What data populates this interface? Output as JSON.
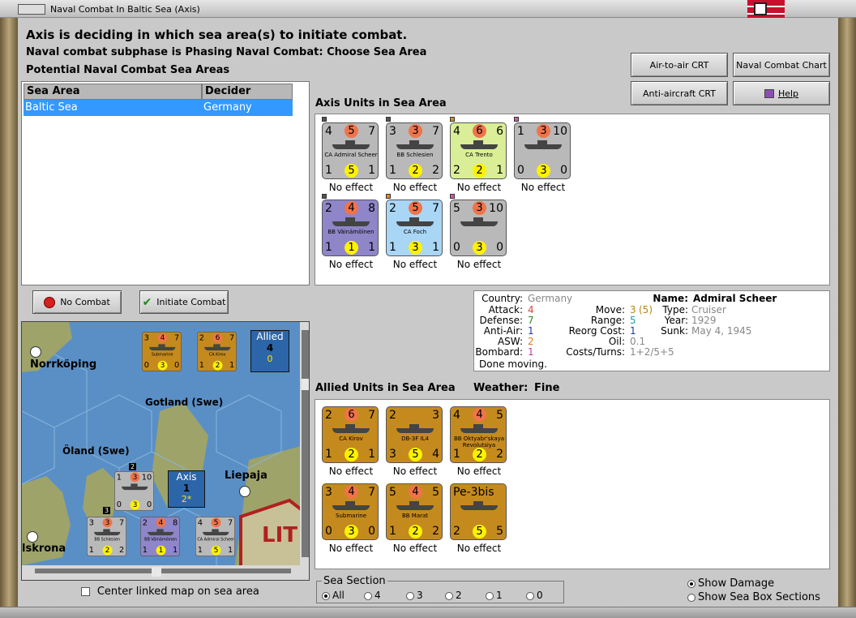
{
  "window": {
    "title": "Naval Combat In Baltic Sea (Axis)"
  },
  "header": {
    "line1": "Axis is deciding in which sea area(s) to initiate combat.",
    "line2": "Naval combat subphase is Phasing Naval Combat: Choose Sea Area",
    "line3": "Potential Naval Combat Sea Areas"
  },
  "sea_table": {
    "columns": [
      "Sea Area",
      "Decider"
    ],
    "rows": [
      {
        "sea_area": "Baltic Sea",
        "decider": "Germany"
      }
    ]
  },
  "buttons": {
    "air_to_air": "Air-to-air CRT",
    "naval_chart": "Naval Combat Chart",
    "anti_aircraft": "Anti-aircraft CRT",
    "help": "Help",
    "no_combat": "No Combat",
    "initiate_combat": "Initiate Combat"
  },
  "axis": {
    "label": "Axis Units in Sea Area",
    "units": [
      {
        "tl": "4",
        "c": "5",
        "tr": "7",
        "name": "CA Admiral Scheer",
        "bl": "1",
        "y": "5",
        "br": "1",
        "status": "No effect",
        "color": "#b9b9b9",
        "pip": "#555555"
      },
      {
        "tl": "3",
        "c": "3",
        "tr": "7",
        "name": "BB Schlesien",
        "bl": "1",
        "y": "2",
        "br": "2",
        "status": "No effect",
        "color": "#b9b9b9",
        "pip": "#555555"
      },
      {
        "tl": "4",
        "c": "6",
        "tr": "6",
        "name": "CA Trento",
        "bl": "2",
        "y": "2",
        "br": "1",
        "status": "No effect",
        "color": "#d9ee96",
        "pip": "#e08a1e"
      },
      {
        "tl": "1",
        "c": "3",
        "tr": "10",
        "name": "",
        "bl": "0",
        "y": "3",
        "br": "0",
        "status": "No effect",
        "color": "#b9b9b9",
        "pip": "#d05ab0"
      },
      {
        "tl": "2",
        "c": "4",
        "tr": "8",
        "name": "BB Väinämöinen",
        "bl": "1",
        "y": "1",
        "br": "1",
        "status": "No effect",
        "color": "#8e86c8",
        "pip": "#555555"
      },
      {
        "tl": "2",
        "c": "5",
        "tr": "7",
        "name": "CA Foch",
        "bl": "1",
        "y": "3",
        "br": "1",
        "status": "No effect",
        "color": "#a9d6f5",
        "pip": "#e08a1e"
      },
      {
        "tl": "5",
        "c": "3",
        "tr": "10",
        "name": "",
        "bl": "0",
        "y": "3",
        "br": "0",
        "status": "No effect",
        "color": "#b9b9b9",
        "pip": "#d05ab0"
      }
    ]
  },
  "allied": {
    "label": "Allied Units in Sea Area",
    "weather_label": "Weather:",
    "weather_value": "Fine",
    "units": [
      {
        "tl": "2",
        "c": "6",
        "tr": "7",
        "name": "CA Kirov",
        "bl": "1",
        "y": "2",
        "br": "1",
        "status": "No effect"
      },
      {
        "tl": "2",
        "c": "",
        "tr": "3",
        "name": "DB-3F IL4",
        "bl": "3",
        "y": "5",
        "br": "4",
        "status": "No effect"
      },
      {
        "tl": "4",
        "c": "4",
        "tr": "5",
        "name": "BB Oktyabr'skaya Revolutsiya",
        "bl": "1",
        "y": "2",
        "br": "2",
        "status": "No effect"
      },
      {
        "tl": "3",
        "c": "4",
        "tr": "7",
        "name": "Submarine",
        "bl": "0",
        "y": "3",
        "br": "0",
        "status": "No effect"
      },
      {
        "tl": "5",
        "c": "4",
        "tr": "5",
        "name": "BB Marat",
        "bl": "1",
        "y": "2",
        "br": "2",
        "status": "No effect"
      },
      {
        "tl": "Pe-3bis",
        "c": "",
        "tr": "",
        "name": "",
        "bl": "2",
        "y": "5",
        "br": "5",
        "status": "No effect"
      }
    ]
  },
  "info": {
    "country_label": "Country:",
    "country": "Germany",
    "attack_label": "Attack:",
    "attack": "4",
    "defense_label": "Defense:",
    "defense": "7",
    "antiair_label": "Anti-Air:",
    "antiair": "1",
    "asw_label": "ASW:",
    "asw": "2",
    "bombard_label": "Bombard:",
    "bombard": "1",
    "move_label": "Move:",
    "move": "3",
    "move_extra": "(5)",
    "range_label": "Range:",
    "range": "5",
    "reorg_label": "Reorg Cost:",
    "reorg": "1",
    "oil_label": "Oil:",
    "oil": "0.1",
    "costs_label": "Costs/Turns:",
    "costs": "1+2/5+5",
    "name_label": "Name:",
    "name": "Admiral Scheer",
    "type_label": "Type:",
    "type": "Cruiser",
    "year_label": "Year:",
    "year": "1929",
    "sunk_label": "Sunk:",
    "sunk": "May 4, 1945",
    "done": "Done moving."
  },
  "map": {
    "labels": {
      "norrkoping": "Norrköping",
      "gotland": "Gotland (Swe)",
      "oland": "Öland (Swe)",
      "liepaja": "Liepaja",
      "karlskrona": "lskrona",
      "lit": "LIT"
    },
    "allied_box": {
      "title": "Allied",
      "count": "4",
      "sub": "0"
    },
    "axis_box": {
      "title": "Axis",
      "count": "1",
      "sub": "2*"
    },
    "stack_badge_a": "2",
    "stack_badge_b": "3",
    "counters": [
      {
        "tl": "3",
        "c": "4",
        "tr": "7",
        "name": "Submarine",
        "bl": "0",
        "y": "3",
        "br": "0"
      },
      {
        "tl": "2",
        "c": "6",
        "tr": "7",
        "name": "CA Kirov",
        "bl": "1",
        "y": "2",
        "br": "1"
      },
      {
        "tl": "1",
        "c": "3",
        "tr": "10",
        "name": "",
        "bl": "0",
        "y": "3",
        "br": "0"
      },
      {
        "tl": "3",
        "c": "3",
        "tr": "7",
        "name": "BB Schlesien",
        "bl": "1",
        "y": "2",
        "br": "2"
      },
      {
        "tl": "2",
        "c": "4",
        "tr": "8",
        "name": "BB Väinämöinen",
        "bl": "1",
        "y": "1",
        "br": "1"
      },
      {
        "tl": "4",
        "c": "5",
        "tr": "7",
        "name": "CA Admiral Scheer",
        "bl": "1",
        "y": "5",
        "br": "1"
      }
    ]
  },
  "center_linked": "Center linked map on sea area",
  "sea_section": {
    "label": "Sea Section",
    "options": [
      "All",
      "4",
      "3",
      "2",
      "1",
      "0"
    ],
    "selected": "All"
  },
  "show_damage": "Show Damage",
  "show_sections": "Show Sea Box Sections"
}
